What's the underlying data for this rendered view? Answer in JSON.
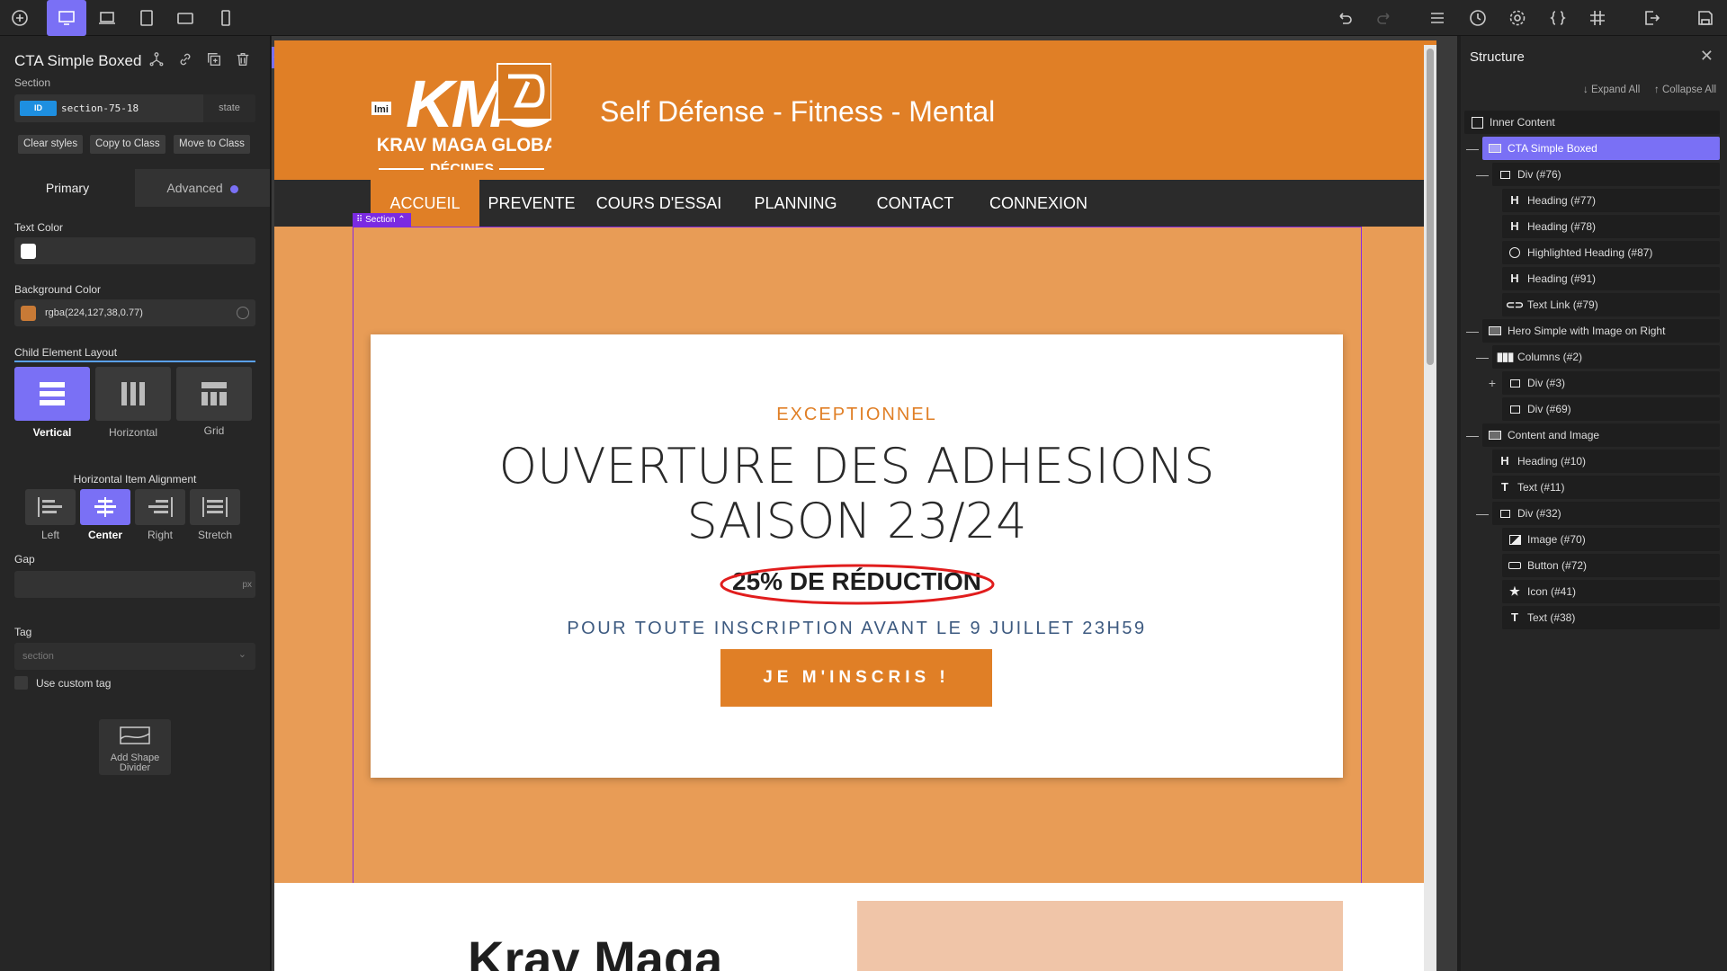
{
  "element": {
    "title": "CTA Simple Boxed",
    "type_label": "Section",
    "id_badge": "ID",
    "id_value": "section-75-18",
    "state_label": "state"
  },
  "actions": {
    "clear": "Clear styles",
    "copy": "Copy to Class",
    "move": "Move to Class"
  },
  "tabs": {
    "primary": "Primary",
    "advanced": "Advanced"
  },
  "text_color": {
    "label": "Text Color",
    "value": "#ffffff"
  },
  "bg_color": {
    "label": "Background Color",
    "value": "rgba(224,127,38,0.77)"
  },
  "child_layout": {
    "label": "Child Element Layout",
    "options": [
      "Vertical",
      "Horizontal",
      "Grid"
    ],
    "selected": "Vertical"
  },
  "h_align": {
    "label": "Horizontal Item Alignment",
    "options": [
      "Left",
      "Center",
      "Right",
      "Stretch"
    ],
    "selected": "Center"
  },
  "gap": {
    "label": "Gap",
    "unit": "px"
  },
  "tag": {
    "label": "Tag",
    "value": "section",
    "custom": "Use custom tag"
  },
  "shape_divider": {
    "label": "Add Shape Divider"
  },
  "site": {
    "logo_top": "KMG",
    "logo_mid": "KRAV MAGA GLOBAL",
    "logo_bottom": "DÉCINES",
    "logo_badge": "lmi",
    "tagline": "Self Défense - Fitness - Mental",
    "nav": [
      "ACCUEIL",
      "PREVENTE",
      "COURS D'ESSAI",
      "PLANNING",
      "CONTACT",
      "CONNEXION"
    ],
    "section_tag": "Section",
    "eyebrow": "EXCEPTIONNEL",
    "heading_line1": "OUVERTURE DES ADHESIONS",
    "heading_line2": "SAISON 23/24",
    "highlight": "25% DE RÉDUCTION",
    "subtext": "POUR TOUTE INSCRIPTION AVANT LE 9 JUILLET 23H59",
    "cta": "JE M'INSCRIS !",
    "below_heading": "Krav Maga"
  },
  "structure": {
    "title": "Structure",
    "expand": "Expand All",
    "collapse": "Collapse All",
    "items": [
      {
        "label": "Inner Content",
        "icon": "list"
      },
      {
        "label": "CTA Simple Boxed",
        "icon": "section"
      },
      {
        "label": "Div (#76)",
        "icon": "div"
      },
      {
        "label": "Heading (#77)",
        "icon": "H"
      },
      {
        "label": "Heading (#78)",
        "icon": "H"
      },
      {
        "label": "Highlighted Heading (#87)",
        "icon": "highlight"
      },
      {
        "label": "Heading (#91)",
        "icon": "H"
      },
      {
        "label": "Text Link (#79)",
        "icon": "link"
      },
      {
        "label": "Hero Simple with Image on Right",
        "icon": "section"
      },
      {
        "label": "Columns (#2)",
        "icon": "columns"
      },
      {
        "label": "Div (#3)",
        "icon": "div"
      },
      {
        "label": "Div (#69)",
        "icon": "div"
      },
      {
        "label": "Content and Image",
        "icon": "section"
      },
      {
        "label": "Heading (#10)",
        "icon": "H"
      },
      {
        "label": "Text (#11)",
        "icon": "T"
      },
      {
        "label": "Div (#32)",
        "icon": "div"
      },
      {
        "label": "Image (#70)",
        "icon": "image"
      },
      {
        "label": "Button (#72)",
        "icon": "button"
      },
      {
        "label": "Icon (#41)",
        "icon": "star"
      },
      {
        "label": "Text (#38)",
        "icon": "T"
      }
    ]
  }
}
